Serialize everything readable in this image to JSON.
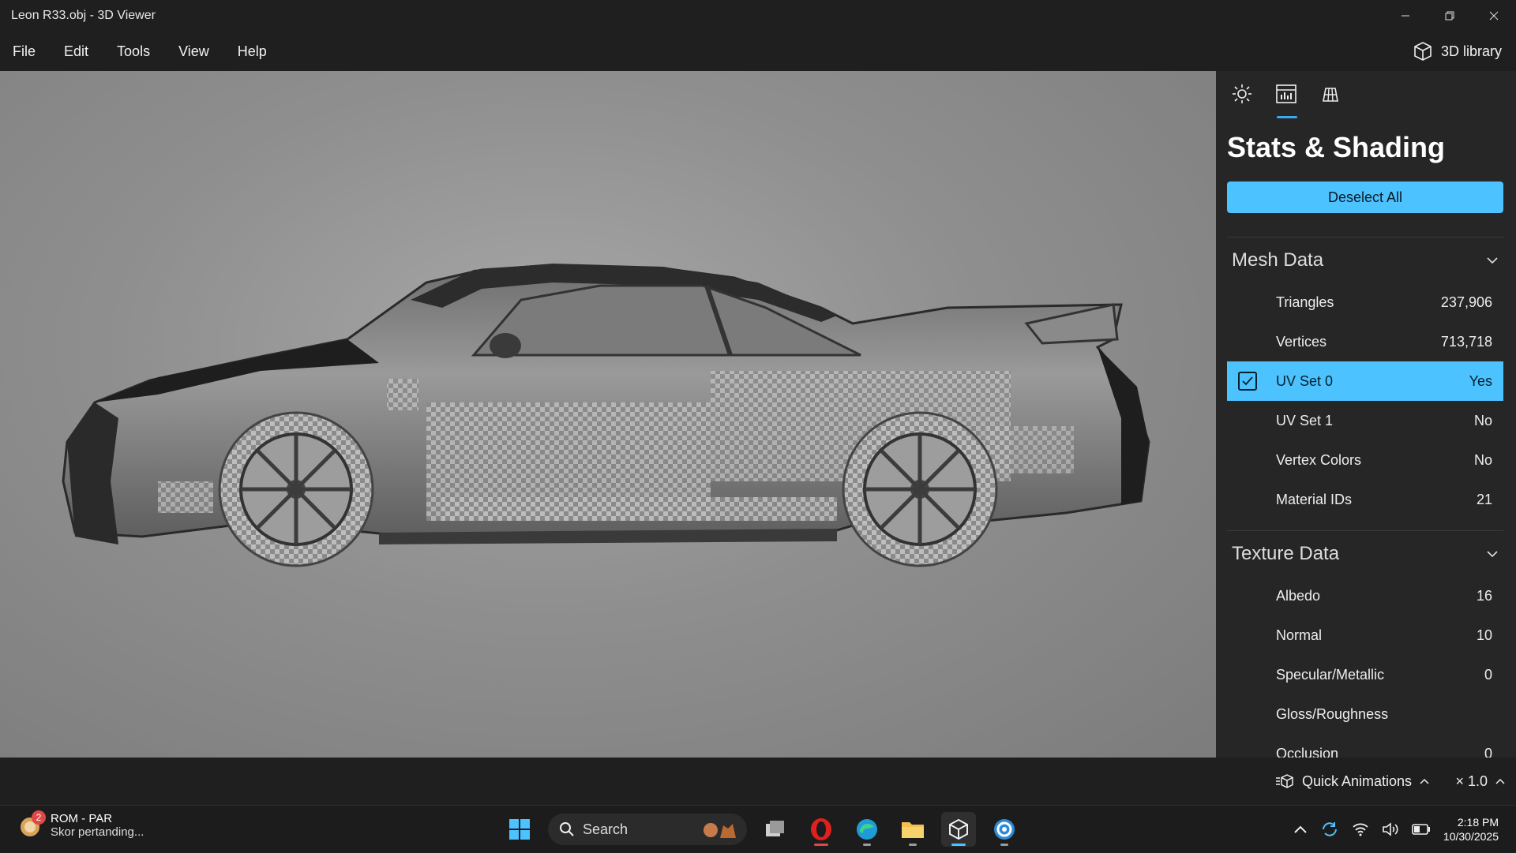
{
  "window": {
    "title": "Leon R33.obj - 3D Viewer"
  },
  "menu": {
    "items": [
      "File",
      "Edit",
      "Tools",
      "View",
      "Help"
    ],
    "library_label": "3D library"
  },
  "panel": {
    "title": "Stats & Shading",
    "deselect_label": "Deselect All",
    "mesh": {
      "header": "Mesh Data",
      "rows": [
        {
          "name": "Triangles",
          "value": "237,906"
        },
        {
          "name": "Vertices",
          "value": "713,718"
        },
        {
          "name": "UV Set 0",
          "value": "Yes"
        },
        {
          "name": "UV Set 1",
          "value": "No"
        },
        {
          "name": "Vertex Colors",
          "value": "No"
        },
        {
          "name": "Material IDs",
          "value": "21"
        }
      ]
    },
    "texture": {
      "header": "Texture Data",
      "rows": [
        {
          "name": "Albedo",
          "value": "16"
        },
        {
          "name": "Normal",
          "value": "10"
        },
        {
          "name": "Specular/Metallic",
          "value": "0"
        },
        {
          "name": "Gloss/Roughness",
          "value": ""
        },
        {
          "name": "Occlusion",
          "value": "0"
        }
      ]
    }
  },
  "bottom": {
    "quick_animations": "Quick Animations",
    "speed": "× 1.0"
  },
  "taskbar": {
    "notif_title": "ROM - PAR",
    "notif_sub": "Skor pertanding...",
    "notif_badge": "2",
    "search_label": "Search",
    "time": "2:18 PM",
    "date": "10/30/2025"
  },
  "colors": {
    "accent": "#4cc2ff",
    "viewport_bg": "#8f8f8f",
    "panel_bg": "#262626"
  }
}
